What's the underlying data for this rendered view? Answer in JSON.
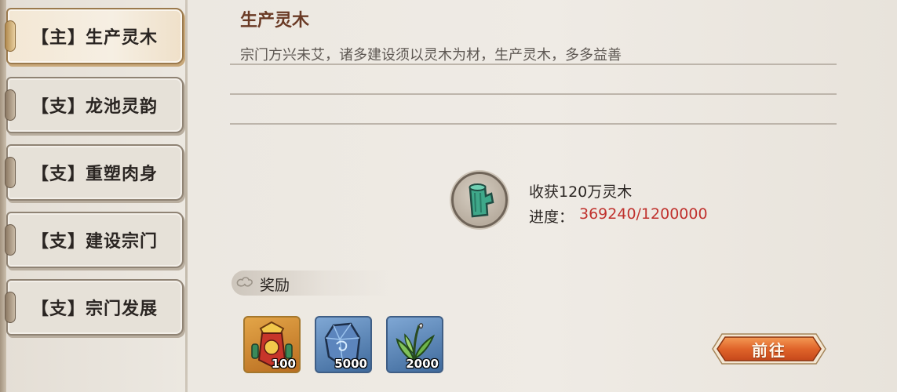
{
  "tabs": [
    {
      "label": "【主】生产灵木",
      "active": true
    },
    {
      "label": "【支】龙池灵韵",
      "active": false
    },
    {
      "label": "【支】重塑肉身",
      "active": false
    },
    {
      "label": "【支】建设宗门",
      "active": false
    },
    {
      "label": "【支】宗门发展",
      "active": false
    }
  ],
  "quest": {
    "title": "生产灵木",
    "description": "宗门方兴未艾，诸多建设须以灵木为材，生产灵木，多多益善"
  },
  "goal": {
    "icon": "spirit-wood-log-icon",
    "text": "收获120万灵木",
    "progress_label": "进度：",
    "progress_value": "369240/1200000",
    "progress_color": "#c0312d"
  },
  "rewards": {
    "title": "奖励",
    "items": [
      {
        "icon": "sect-banner-icon",
        "count": "100",
        "rarity_color": "#d98d2f"
      },
      {
        "icon": "spirit-stone-icon",
        "count": "5000",
        "rarity_color": "#5a86bd"
      },
      {
        "icon": "spirit-herb-icon",
        "count": "2000",
        "rarity_color": "#5a86bd"
      }
    ]
  },
  "actions": {
    "go_label": "前往",
    "go_color": "#e0642a"
  }
}
